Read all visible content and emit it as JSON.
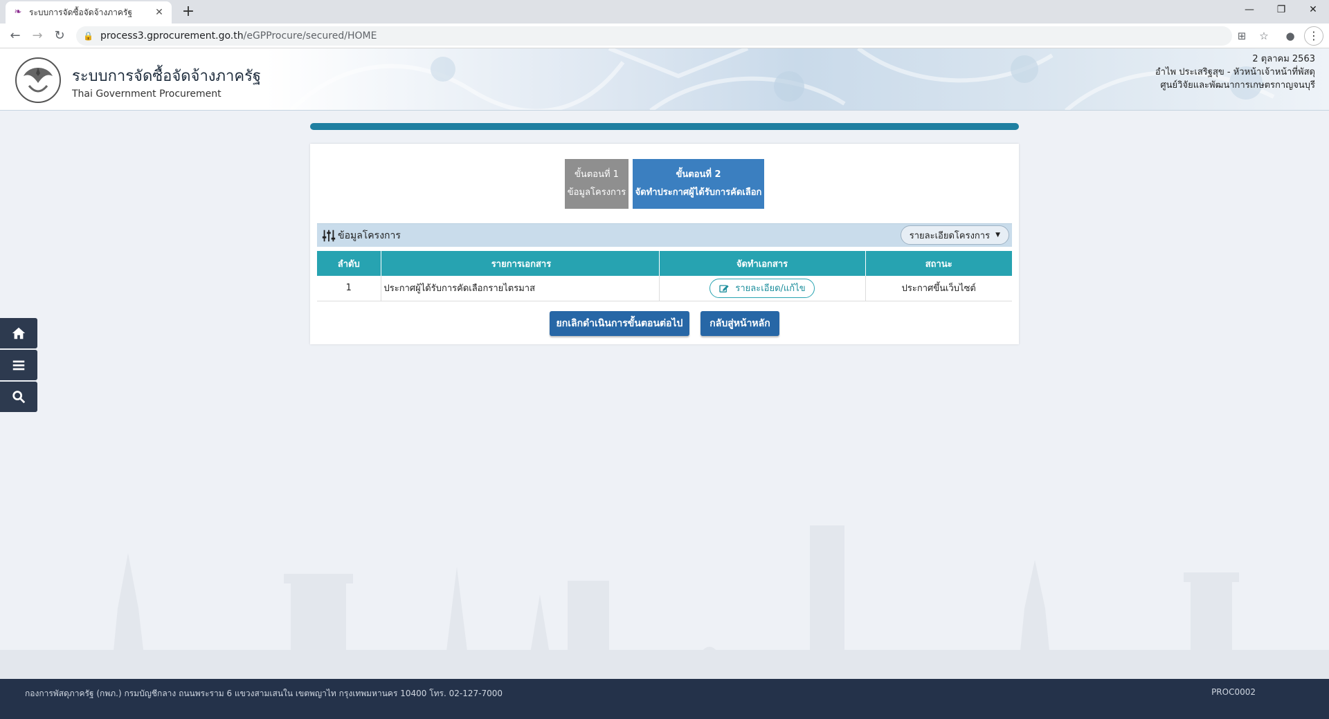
{
  "browser": {
    "tab_title": "ระบบการจัดซื้อจัดจ้างภาครัฐ",
    "url_host": "process3.gprocurement.go.th",
    "url_path": "/eGPProcure/secured/HOME"
  },
  "header": {
    "title": "ระบบการจัดซื้อจัดจ้างภาครัฐ",
    "subtitle": "Thai Government Procurement",
    "date": "2 ตุลาคม 2563",
    "user": "อำไพ ประเสริฐสุข - หัวหน้าเจ้าหน้าที่พัสดุ",
    "org": "ศูนย์วิจัยและพัฒนาการเกษตรกาญจนบุรี"
  },
  "steps": [
    {
      "line1": "ขั้นตอนที่ 1",
      "line2": "ข้อมูลโครงการ",
      "active": false
    },
    {
      "line1": "ขั้นตอนที่ 2",
      "line2": "จัดทำประกาศผู้ได้รับการคัดเลือก",
      "active": true
    }
  ],
  "section": {
    "title": "ข้อมูลโครงการ",
    "detail_button": "รายละเอียดโครงการ"
  },
  "table": {
    "headers": [
      "ลำดับ",
      "รายการเอกสาร",
      "จัดทำเอกสาร",
      "สถานะ"
    ],
    "rows": [
      {
        "no": "1",
        "name": "ประกาศผู้ได้รับการคัดเลือกรายไตรมาส",
        "action": "รายละเอียด/แก้ไข",
        "status": "ประกาศขึ้นเว็บไซต์"
      }
    ]
  },
  "buttons": {
    "cancel": "ยกเลิกดำเนินการขั้นตอนต่อไป",
    "home": "กลับสู่หน้าหลัก"
  },
  "footer": {
    "address": "กองการพัสดุภาครัฐ (กพภ.) กรมบัญชีกลาง ถนนพระราม 6 แขวงสามเสนใน เขตพญาไท กรุงเทพมหานคร 10400 โทร. 02-127-7000",
    "code": "PROC0002"
  },
  "colors": {
    "teal": "#27a3b1",
    "step_active": "#3b7fc0",
    "step_inactive": "#8f8f8f",
    "action_blue": "#2767a6",
    "footer": "#24324a"
  },
  "icons": {
    "side_home": "home-icon",
    "side_menu": "menu-icon",
    "side_search": "search-icon",
    "section": "sliders-icon",
    "edit": "edit-icon"
  }
}
